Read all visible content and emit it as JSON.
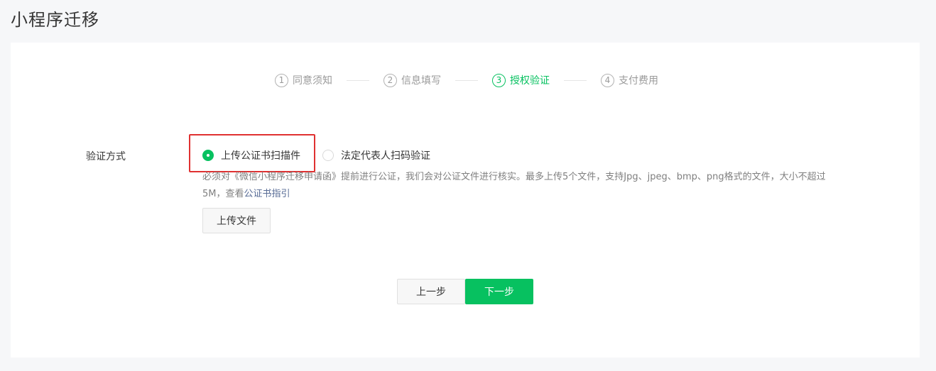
{
  "page": {
    "title": "小程序迁移"
  },
  "steps": [
    {
      "num": "1",
      "label": "同意须知"
    },
    {
      "num": "2",
      "label": "信息填写"
    },
    {
      "num": "3",
      "label": "授权验证"
    },
    {
      "num": "4",
      "label": "支付费用"
    }
  ],
  "active_step": 3,
  "form": {
    "label": "验证方式",
    "options": [
      {
        "label": "上传公证书扫描件",
        "checked": true
      },
      {
        "label": "法定代表人扫码验证",
        "checked": false
      }
    ],
    "description": "必须对《微信小程序迁移申请函》提前进行公证，我们会对公证文件进行核实。最多上传5个文件，支持Jpg、jpeg、bmp、png格式的文件，大小不超过5M，查看",
    "description_link": "公证书指引",
    "upload_label": "上传文件"
  },
  "buttons": {
    "prev": "上一步",
    "next": "下一步"
  },
  "colors": {
    "accent": "#07c160",
    "highlight": "#e03131",
    "link": "#576b95"
  }
}
